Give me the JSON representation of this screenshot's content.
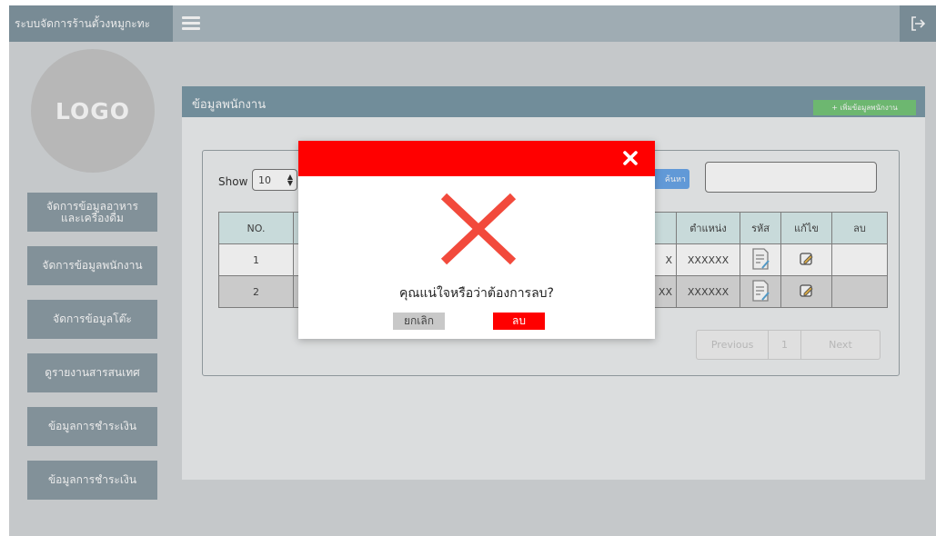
{
  "app": {
    "title": "ระบบจัดการร้านตั้วงหมูกะทะ"
  },
  "topbar": {
    "menu_icon": "hamburger-icon",
    "logout_icon": "logout-icon"
  },
  "sidebar": {
    "logo_text": "LOGO",
    "items": [
      {
        "label": "จัดการข้อมูลอาหาร\nและเครื่องดื่ม"
      },
      {
        "label": "จัดการข้อมูลพนักงาน"
      },
      {
        "label": "จัดการข้อมูลโต๊ะ"
      },
      {
        "label": "ดูรายงานสารสนเทศ"
      },
      {
        "label": "ข้อมูลการชำระเงิน"
      },
      {
        "label": "ข้อมูลการชำระเงิน"
      }
    ]
  },
  "panel": {
    "title": "ข้อมูลพนักงาน",
    "add_label": "+ เพิ่มข้อมูลพนักงาน"
  },
  "controls": {
    "show_label": "Show",
    "show_value": "10",
    "search_label": "ค้นหา"
  },
  "table": {
    "columns": [
      "NO.",
      "",
      "",
      "ตำแหน่ง",
      "รหัส",
      "แก้ไข",
      "ลบ"
    ],
    "rows": [
      {
        "no": "1",
        "partial": "X",
        "position": "XXXXXX"
      },
      {
        "no": "2",
        "partial": "XX",
        "position": "XXXXXX"
      }
    ]
  },
  "pager": {
    "previous": "Previous",
    "page": "1",
    "next": "Next"
  },
  "colors": {
    "header": "#7b9aa8",
    "danger": "#ff0000",
    "sidebar_item": "#8e9ea7"
  },
  "modal": {
    "question": "คุณแน่ใจหรือว่าต้องการลบ?",
    "cancel_label": "ยกเลิก",
    "delete_label": "ลบ"
  }
}
